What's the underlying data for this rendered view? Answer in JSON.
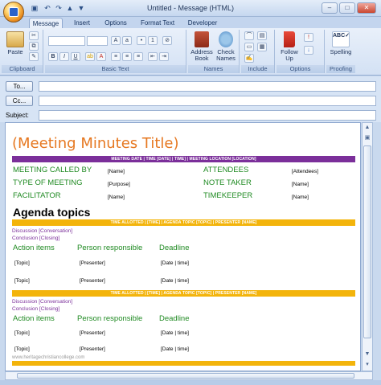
{
  "window": {
    "title": "Untitled - Message (HTML)",
    "minimize": "–",
    "maximize": "□",
    "close": "✕"
  },
  "tabs": [
    "Message",
    "Insert",
    "Options",
    "Format Text",
    "Developer"
  ],
  "ribbon": {
    "clipboard": {
      "paste": "Paste",
      "label": "Clipboard"
    },
    "basic_text": {
      "label": "Basic Text"
    },
    "names": {
      "address_book": "Address Book",
      "check_names": "Check Names",
      "label": "Names"
    },
    "include": {
      "label": "Include"
    },
    "options": {
      "follow_up": "Follow Up",
      "label": "Options"
    },
    "proofing": {
      "spelling": "Spelling",
      "label": "Proofing"
    }
  },
  "fields": {
    "to_button": "To...",
    "cc_button": "Cc...",
    "subject_label": "Subject:",
    "to_value": "",
    "cc_value": "",
    "subject_value": ""
  },
  "doc": {
    "title": "(Meeting Minutes Title)",
    "header_bar": "MEETING DATE | TIME [DATE] | TIME] | MEETING LOCATION [LOCATION]",
    "meeting_called_by": "MEETING CALLED BY",
    "type_of_meeting": "TYPE OF MEETING",
    "facilitator": "FACILITATOR",
    "attendees": "ATTENDEES",
    "note_taker": "NOTE TAKER",
    "timekeeper": "TIMEKEEPER",
    "name_ph": "[Name]",
    "purpose_ph": "[Purpose]",
    "attendees_ph": "[Attendees]",
    "agenda_heading": "Agenda topics",
    "topic_bar": "TIME ALLOTTED | [TIME] | AGENDA TOPIC [TOPIC] | PRESENTER [NAME]",
    "discussion": "Discussion [Conversation]",
    "conclusion": "Conclusion [Closing]",
    "action_items": "Action items",
    "person_responsible": "Person responsible",
    "deadline": "Deadline",
    "topic_ph": "[Topic]",
    "presenter_ph": "[Presenter]",
    "date_time_ph": "[Date | time]",
    "footer": "www.heritagechristiancollege.com"
  },
  "colors": {
    "purple": "#7b2f9a",
    "gold": "#f3b40b",
    "orange": "#e67821",
    "green": "#1f8a22"
  }
}
